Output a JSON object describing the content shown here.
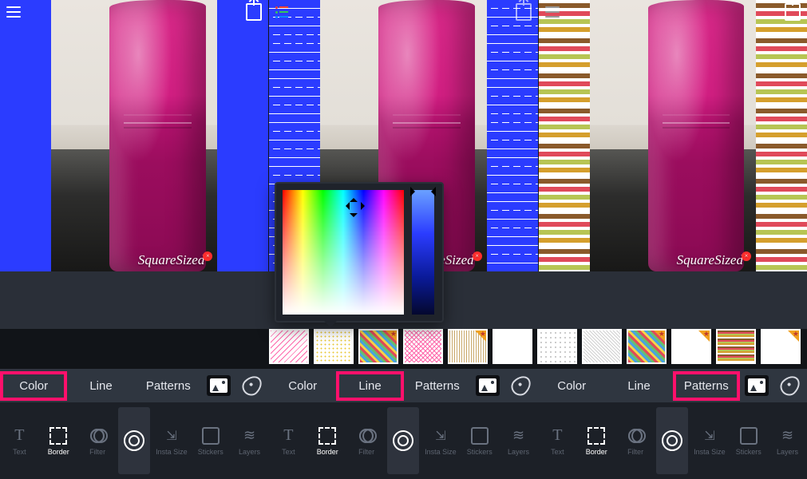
{
  "watermark": "SquareSized",
  "panes": [
    {
      "border_style": "solid",
      "border_color": "#2b3cff",
      "highlight_tab": "Color"
    },
    {
      "border_style": "dash-pattern",
      "border_color": "#2b3cff",
      "highlight_tab": "Line",
      "color_picker_open": true
    },
    {
      "border_style": "stripes",
      "highlight_tab": "Patterns"
    }
  ],
  "sub_tabs": {
    "color": "Color",
    "line": "Line",
    "patterns": "Patterns"
  },
  "pattern_swatches": [
    {
      "name": "wave-pink",
      "premium": false
    },
    {
      "name": "dots-yellow",
      "premium": false
    },
    {
      "name": "diag-multi",
      "premium": true
    },
    {
      "name": "zigzag-pink",
      "premium": false
    },
    {
      "name": "chevron-tan",
      "premium": true
    },
    {
      "name": "plain-white",
      "premium": false
    },
    {
      "name": "dots-grey",
      "premium": false
    },
    {
      "name": "fine-diag",
      "premium": false
    },
    {
      "name": "diagonal-stripes",
      "premium": true
    },
    {
      "name": "arrow-corner",
      "premium": true
    },
    {
      "name": "stripes-hor",
      "premium": false
    },
    {
      "name": "more",
      "premium": true
    }
  ],
  "dock": {
    "text": "Text",
    "border": "Border",
    "filter": "Filter",
    "insta": "Insta Size",
    "stickers": "Stickers",
    "layers": "Layers"
  },
  "active_dock": "Border"
}
